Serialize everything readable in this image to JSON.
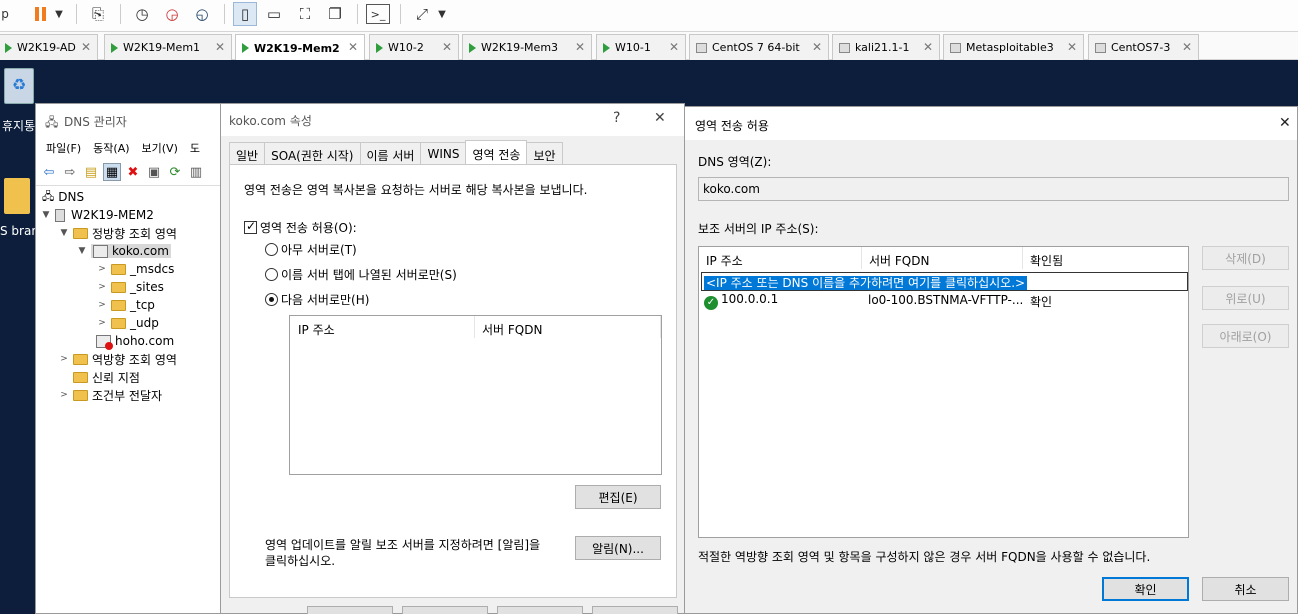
{
  "toolbar": {
    "cut_text": "p"
  },
  "vm_tabs": [
    {
      "label": "W2K19-AD"
    },
    {
      "label": "W2K19-Mem1"
    },
    {
      "label": "W2K19-Mem2"
    },
    {
      "label": "W10-2"
    },
    {
      "label": "W2K19-Mem3"
    },
    {
      "label": "W10-1"
    },
    {
      "label": "CentOS 7 64-bit"
    },
    {
      "label": "kali21.1-1"
    },
    {
      "label": "Metasploitable3"
    },
    {
      "label": "CentOS7-3"
    }
  ],
  "desktop": {
    "recycle_bin": "휴지통",
    "folder_cut": "S bran"
  },
  "dns_manager": {
    "title": "DNS 관리자",
    "menu": [
      "파일(F)",
      "동작(A)",
      "보기(V)",
      "도"
    ],
    "tree": {
      "root": "DNS",
      "server": "W2K19-MEM2",
      "forward": "정방향 조회 영역",
      "zone": "koko.com",
      "children": [
        "_msdcs",
        "_sites",
        "_tcp",
        "_udp"
      ],
      "zone2": "hoho.com",
      "reverse": "역방향 조회 영역",
      "trust": "신뢰 지점",
      "cond": "조건부 전달자"
    }
  },
  "props": {
    "title": "koko.com 속성",
    "help": "?",
    "close": "✕",
    "tabs": [
      "일반",
      "SOA(권한 시작)",
      "이름 서버",
      "WINS",
      "영역 전송",
      "보안"
    ],
    "desc": "영역 전송은 영역 복사본을 요청하는 서버로 해당 복사본을 보냅니다.",
    "allow_label": "영역 전송 허용(O):",
    "radio_any": "아무 서버로(T)",
    "radio_ns": "이름 서버 탭에 나열된 서버로만(S)",
    "radio_these": "다음 서버로만(H)",
    "col_ip": "IP 주소",
    "col_fqdn": "서버 FQDN",
    "edit_btn": "편집(E)",
    "notify_text_1": "영역 업데이트를 알릴 보조 서버를 지정하려면 [알림]을",
    "notify_text_2": "클릭하십시오.",
    "notify_btn": "알림(N)..."
  },
  "zone_transfer": {
    "title": "영역 전송 허용",
    "close": "✕",
    "zone_label": "DNS 영역(Z):",
    "zone_value": "koko.com",
    "list_label": "보조 서버의 IP 주소(S):",
    "col_ip": "IP 주소",
    "col_fqdn": "서버 FQDN",
    "col_status": "확인됨",
    "add_hint": "<IP 주소 또는 DNS 이름을 추가하려면 여기를 클릭하십시오.>",
    "row": {
      "ip": "100.0.0.1",
      "fqdn": "lo0-100.BSTNMA-VFTTP-...",
      "status": "확인"
    },
    "btn_delete": "삭제(D)",
    "btn_up": "위로(U)",
    "btn_down": "아래로(O)",
    "footer": "적절한 역방향 조회 영역 및 항목을 구성하지 않은 경우 서버 FQDN을 사용할 수 없습니다.",
    "ok": "확인",
    "cancel": "취소"
  }
}
